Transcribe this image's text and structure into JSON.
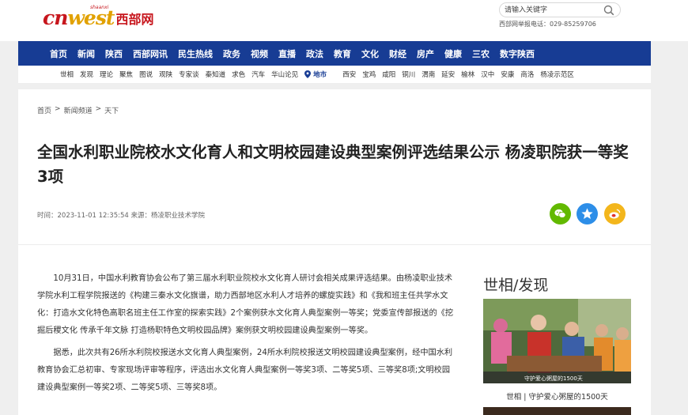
{
  "header": {
    "logo_text_1": "cn",
    "logo_text_2": "west",
    "logo_cn_name": "西部网",
    "logo_sub": "shaanxi",
    "search_placeholder": "请输入关键字",
    "hotline": "西部网举报电话：029-85259706"
  },
  "nav": {
    "items": [
      "首页",
      "新闻",
      "陕西",
      "西部网讯",
      "民生热线",
      "政务",
      "视频",
      "直播",
      "政法",
      "教育",
      "文化",
      "财经",
      "房产",
      "健康",
      "三农",
      "数字陕西"
    ]
  },
  "subnav": {
    "left": [
      "世相",
      "发现",
      "理论",
      "聚焦",
      "图说",
      "观陕",
      "专家谈",
      "秦知道",
      "求色",
      "汽车",
      "华山论见"
    ],
    "region_label": "地市",
    "right": [
      "西安",
      "宝鸡",
      "咸阳",
      "铜川",
      "渭南",
      "延安",
      "榆林",
      "汉中",
      "安康",
      "商洛",
      "杨凌示范区"
    ]
  },
  "article": {
    "breadcrumb": [
      "首页",
      "新闻频道",
      "天下"
    ],
    "title": "全国水利职业院校水文化育人和文明校园建设典型案例评选结果公示 杨凌职院获一等奖3项",
    "meta": "时间：2023-11-01 12:35:54 来源：杨凌职业技术学院",
    "paragraphs": [
      "10月31日，中国水利教育协会公布了第三届水利职业院校水文化育人研讨会相关成果评选结果。由杨凌职业技术学院水利工程学院报送的《构建三秦水文化旗谱，助力西部地区水利人才培养的螺旋实践》和《我和班主任共学水文化：打造水文化特色高职名班主任工作室的探索实践》2个案例获水文化育人典型案例一等奖；党委宣传部报送的《挖掘后稷文化 传承千年文脉 打造杨职特色文明校园品牌》案例获文明校园建设典型案例一等奖。",
      "据悉，此次共有26所水利院校报送水文化育人典型案例，24所水利院校报送文明校园建设典型案例，经中国水利教育协会汇总初审、专家现场评审等程序，评选出水文化育人典型案例一等奖3项、二等奖5项、三等奖8项;文明校园建设典型案例一等奖2项、二等奖5项、三等奖8项。"
    ]
  },
  "share": {
    "wechat_color": "#62b900",
    "qzone_color": "#2d8ee8",
    "weibo_color": "#f3b61c"
  },
  "sidebar": {
    "title": "世相/发现",
    "image_overlay": "守护爱心粥屋的1500天",
    "caption": "世相 | 守护爱心粥屋的1500天"
  }
}
